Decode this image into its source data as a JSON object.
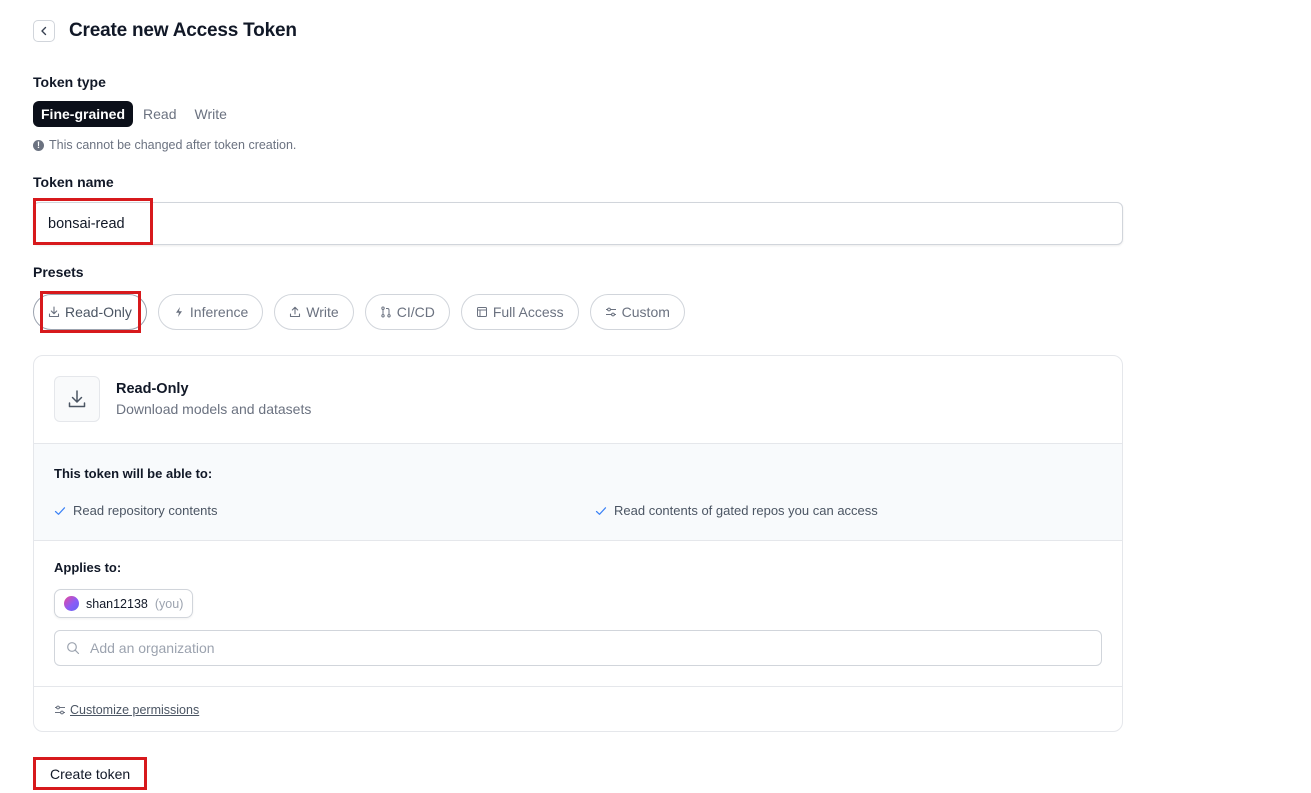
{
  "header": {
    "title": "Create new Access Token"
  },
  "token_type": {
    "label": "Token type",
    "tabs": [
      {
        "label": "Fine-grained",
        "active": true
      },
      {
        "label": "Read",
        "active": false
      },
      {
        "label": "Write",
        "active": false
      }
    ],
    "note": "This cannot be changed after token creation."
  },
  "token_name": {
    "label": "Token name",
    "value": "bonsai-read"
  },
  "presets": {
    "label": "Presets",
    "items": [
      {
        "label": "Read-Only",
        "icon": "download-icon",
        "selected": true
      },
      {
        "label": "Inference",
        "icon": "lightning-icon",
        "selected": false
      },
      {
        "label": "Write",
        "icon": "upload-icon",
        "selected": false
      },
      {
        "label": "CI/CD",
        "icon": "pull-request-icon",
        "selected": false
      },
      {
        "label": "Full Access",
        "icon": "window-icon",
        "selected": false
      },
      {
        "label": "Custom",
        "icon": "sliders-icon",
        "selected": false
      }
    ]
  },
  "card": {
    "title": "Read-Only",
    "description": "Download models and datasets",
    "abilities_label": "This token will be able to:",
    "abilities": [
      "Read repository contents",
      "Read contents of gated repos you can access"
    ],
    "applies_label": "Applies to:",
    "user": {
      "name": "shan12138",
      "suffix": "(you)"
    },
    "org_search": {
      "placeholder": "Add an organization"
    },
    "customize_label": "Customize permissions"
  },
  "create_button": {
    "label": "Create token"
  },
  "colors": {
    "highlight": "#d7191c",
    "active_tab": "#0b0f19",
    "check": "#3b82f6"
  }
}
